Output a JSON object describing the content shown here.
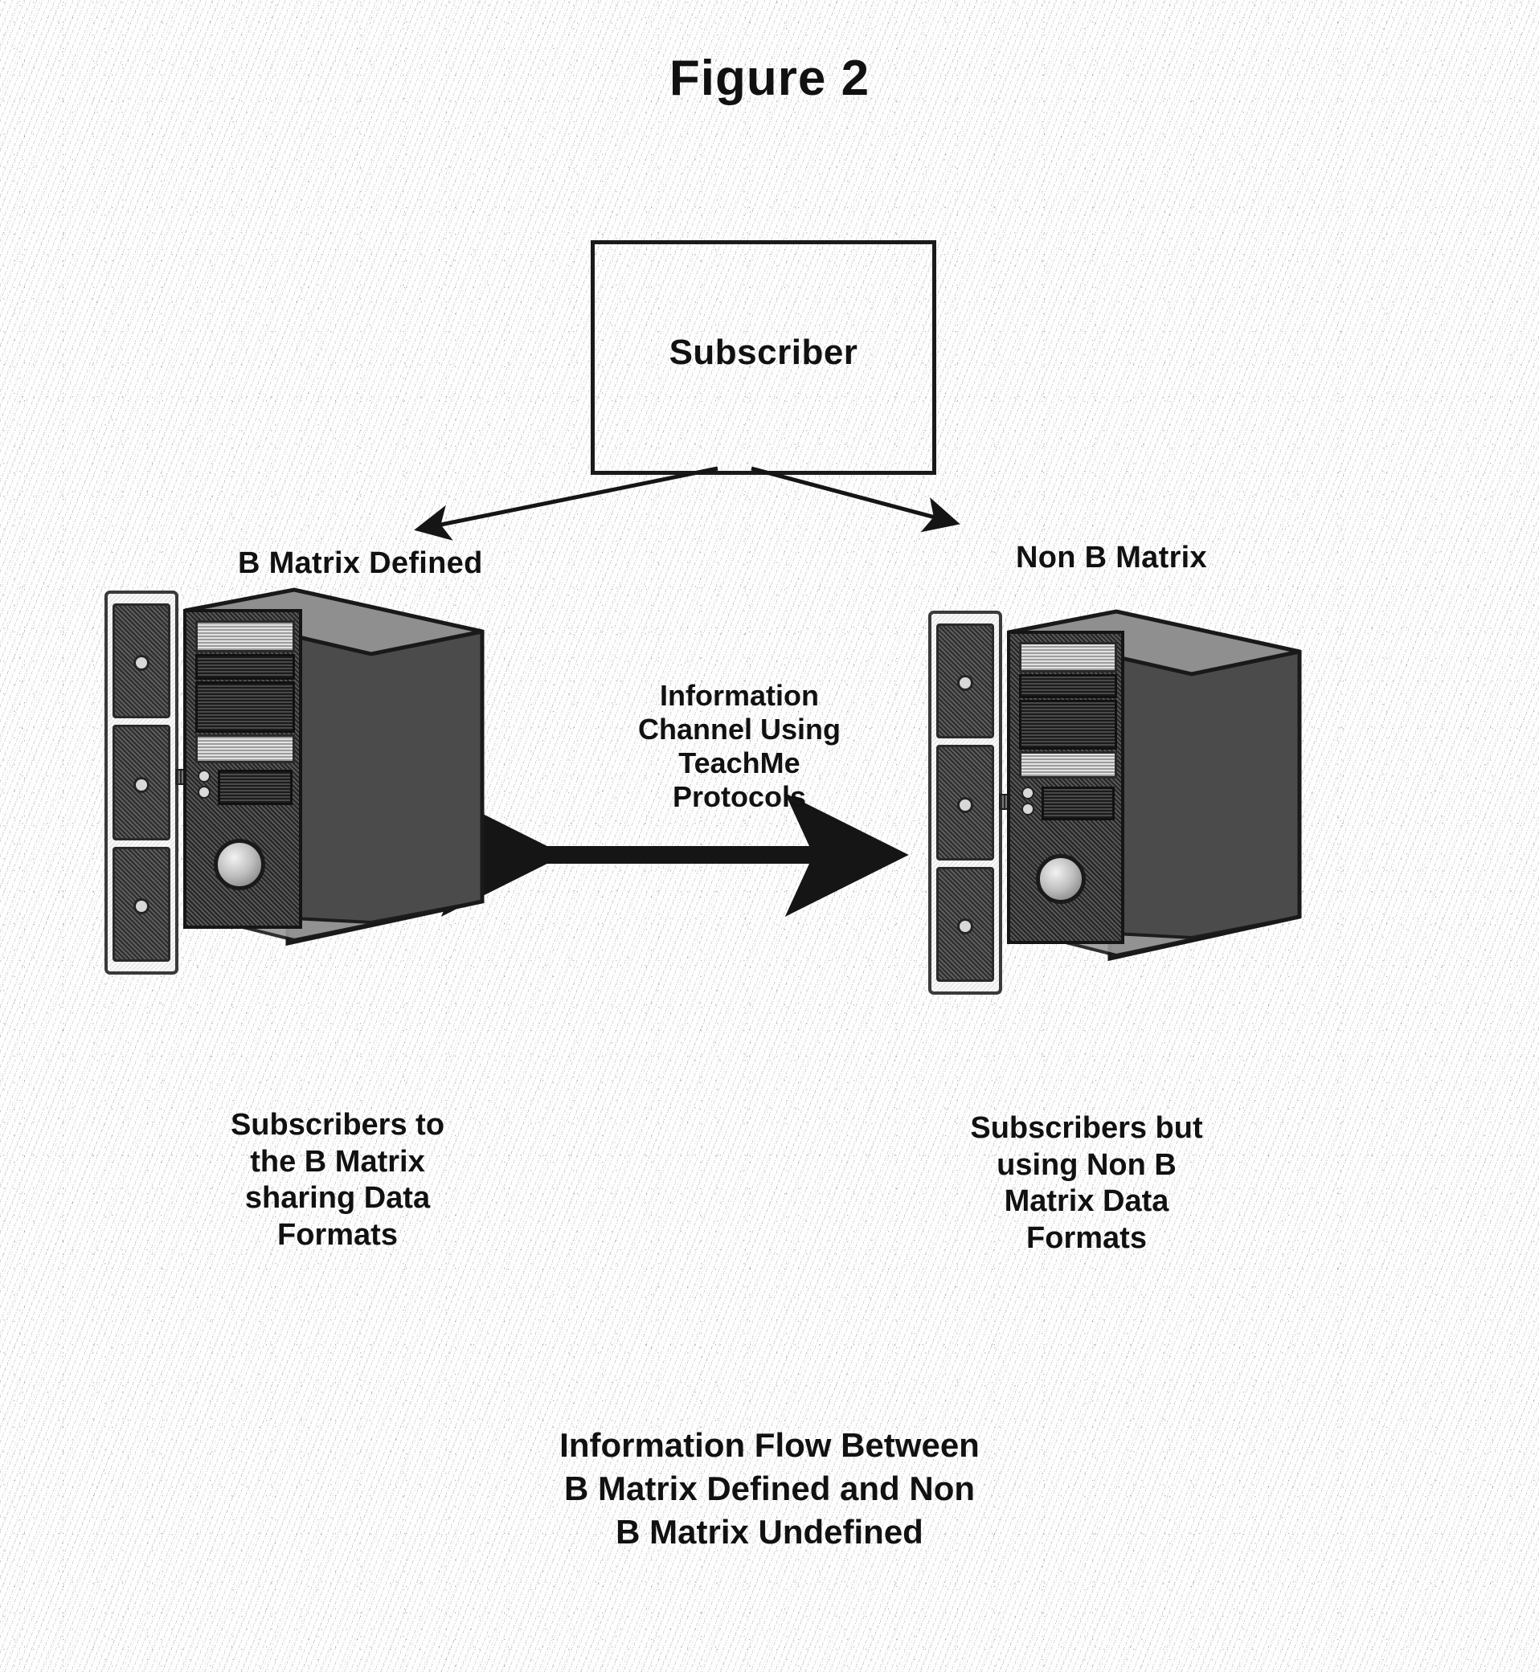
{
  "figure": {
    "title": "Figure 2"
  },
  "subscriber": {
    "label": "Subscriber"
  },
  "nodes": {
    "left": {
      "header": "B Matrix Defined",
      "caption_lines": [
        "Subscribers to",
        "the B Matrix",
        "sharing Data",
        "Formats"
      ],
      "rack_bays": [
        "drive-bay-1",
        "drive-bay-2",
        "drive-bay-3"
      ],
      "tower_name": "computer-tower-left"
    },
    "right": {
      "header": "Non B Matrix",
      "caption_lines": [
        "Subscribers but",
        "using Non B",
        "Matrix Data",
        "Formats"
      ],
      "rack_bays": [
        "drive-bay-1",
        "drive-bay-2",
        "drive-bay-3"
      ],
      "tower_name": "computer-tower-right"
    }
  },
  "channel": {
    "lines": [
      "Information",
      "Channel Using",
      "TeachMe",
      "Protocols"
    ]
  },
  "bottom_caption": {
    "lines": [
      "Information Flow Between",
      "B Matrix Defined and Non",
      "B Matrix  Undefined"
    ]
  },
  "arrows": {
    "subscriber_to_left": "arrow-subscriber-to-left",
    "subscriber_to_right": "arrow-subscriber-to-right",
    "channel_bidirectional": "arrow-channel-bidirectional"
  },
  "colors": {
    "ink": "#111111",
    "paper": "#fefefe",
    "case_dark": "#2a2a2a"
  }
}
